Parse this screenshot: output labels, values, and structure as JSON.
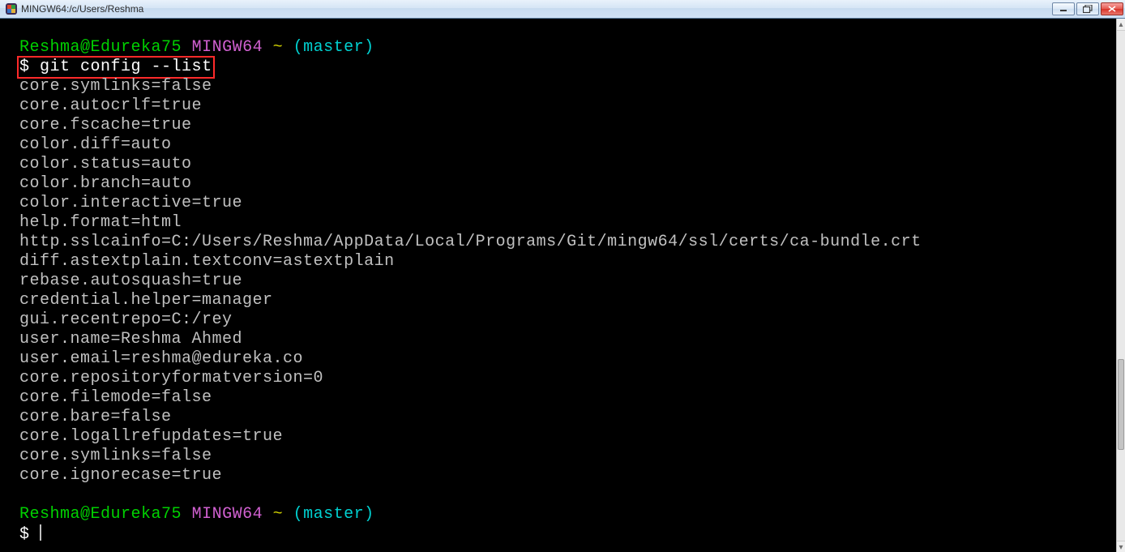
{
  "window": {
    "title": "MINGW64:/c/Users/Reshma"
  },
  "prompt": {
    "user": "Reshma",
    "host": "Edureka75",
    "shell": "MINGW64",
    "tilde": "~",
    "branch": "(master)",
    "symbol": "$"
  },
  "command": "git config --list",
  "output": [
    "core.symlinks=false",
    "core.autocrlf=true",
    "core.fscache=true",
    "color.diff=auto",
    "color.status=auto",
    "color.branch=auto",
    "color.interactive=true",
    "help.format=html",
    "http.sslcainfo=C:/Users/Reshma/AppData/Local/Programs/Git/mingw64/ssl/certs/ca-bundle.crt",
    "diff.astextplain.textconv=astextplain",
    "rebase.autosquash=true",
    "credential.helper=manager",
    "gui.recentrepo=C:/rey",
    "user.name=Reshma Ahmed",
    "user.email=reshma@edureka.co",
    "core.repositoryformatversion=0",
    "core.filemode=false",
    "core.bare=false",
    "core.logallrefupdates=true",
    "core.symlinks=false",
    "core.ignorecase=true"
  ]
}
